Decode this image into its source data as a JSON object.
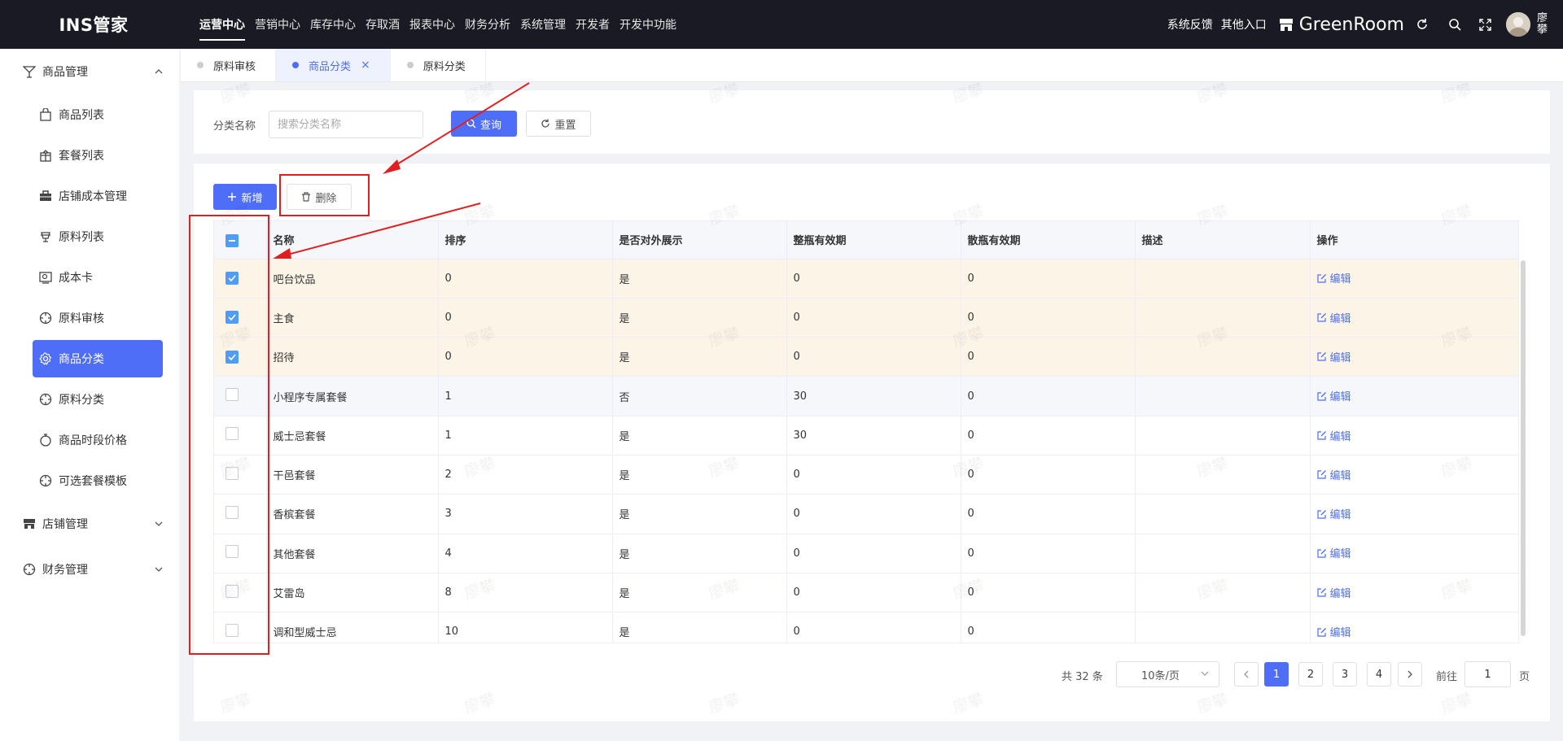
{
  "header": {
    "logo": "INS管家",
    "nav": [
      "运营中心",
      "营销中心",
      "库存中心",
      "存取酒",
      "报表中心",
      "财务分析",
      "系统管理",
      "开发者",
      "开发中功能"
    ],
    "active_nav": "运营中心",
    "links": [
      "系统反馈",
      "其他入口"
    ],
    "brand": "GreenRoom",
    "user": "廖攀"
  },
  "sidebar": {
    "groups": [
      {
        "label": "商品管理",
        "icon": "cocktail-icon",
        "expanded": true,
        "items": [
          {
            "label": "商品列表",
            "icon": "bag-icon"
          },
          {
            "label": "套餐列表",
            "icon": "gift-icon"
          },
          {
            "label": "店铺成本管理",
            "icon": "briefcase-icon"
          },
          {
            "label": "原料列表",
            "icon": "cup-icon"
          },
          {
            "label": "成本卡",
            "icon": "card-icon"
          },
          {
            "label": "原料审核",
            "icon": "crosshair-icon"
          },
          {
            "label": "商品分类",
            "icon": "gear-icon",
            "active": true
          },
          {
            "label": "原料分类",
            "icon": "crosshair-icon"
          },
          {
            "label": "商品时段价格",
            "icon": "timer-icon"
          },
          {
            "label": "可选套餐模板",
            "icon": "crosshair-icon"
          }
        ]
      },
      {
        "label": "店铺管理",
        "icon": "store-icon",
        "expanded": false,
        "items": []
      },
      {
        "label": "财务管理",
        "icon": "crosshair-icon",
        "expanded": false,
        "items": []
      }
    ]
  },
  "tabs": [
    {
      "label": "原料审核",
      "active": false
    },
    {
      "label": "商品分类",
      "active": true,
      "close": "×"
    },
    {
      "label": "原料分类",
      "active": false
    }
  ],
  "search": {
    "label": "分类名称",
    "placeholder": "搜索分类名称",
    "query_label": "查询",
    "reset_label": "重置"
  },
  "toolbar": {
    "add_label": "新增",
    "delete_label": "删除"
  },
  "table": {
    "columns": [
      "名称",
      "排序",
      "是否对外展示",
      "整瓶有效期",
      "散瓶有效期",
      "描述",
      "操作"
    ],
    "edit_label": "编辑",
    "rows": [
      {
        "name": "吧台饮品",
        "sort": "0",
        "show": "是",
        "whole": "0",
        "loose": "0",
        "desc": "",
        "checked": true
      },
      {
        "name": "主食",
        "sort": "0",
        "show": "是",
        "whole": "0",
        "loose": "0",
        "desc": "",
        "checked": true
      },
      {
        "name": "招待",
        "sort": "0",
        "show": "是",
        "whole": "0",
        "loose": "0",
        "desc": "",
        "checked": true
      },
      {
        "name": "小程序专属套餐",
        "sort": "1",
        "show": "否",
        "whole": "30",
        "loose": "0",
        "desc": "",
        "checked": false
      },
      {
        "name": "威士忌套餐",
        "sort": "1",
        "show": "是",
        "whole": "30",
        "loose": "0",
        "desc": "",
        "checked": false
      },
      {
        "name": "干邑套餐",
        "sort": "2",
        "show": "是",
        "whole": "0",
        "loose": "0",
        "desc": "",
        "checked": false
      },
      {
        "name": "香槟套餐",
        "sort": "3",
        "show": "是",
        "whole": "0",
        "loose": "0",
        "desc": "",
        "checked": false
      },
      {
        "name": "其他套餐",
        "sort": "4",
        "show": "是",
        "whole": "0",
        "loose": "0",
        "desc": "",
        "checked": false
      },
      {
        "name": "艾雷岛",
        "sort": "8",
        "show": "是",
        "whole": "0",
        "loose": "0",
        "desc": "",
        "checked": false
      },
      {
        "name": "调和型威士忌",
        "sort": "10",
        "show": "是",
        "whole": "0",
        "loose": "0",
        "desc": "",
        "checked": false
      }
    ]
  },
  "pagination": {
    "total": "共 32 条",
    "page_size": "10条/页",
    "pages": [
      "1",
      "2",
      "3",
      "4"
    ],
    "current": "1",
    "goto_label": "前往",
    "goto_value": "1",
    "page_unit": "页"
  },
  "watermark": "廖攀",
  "colors": {
    "primary": "#4f6ef7",
    "header_bg": "#191a23",
    "selected_row": "#fdf4e8",
    "annotation": "#e02020"
  }
}
